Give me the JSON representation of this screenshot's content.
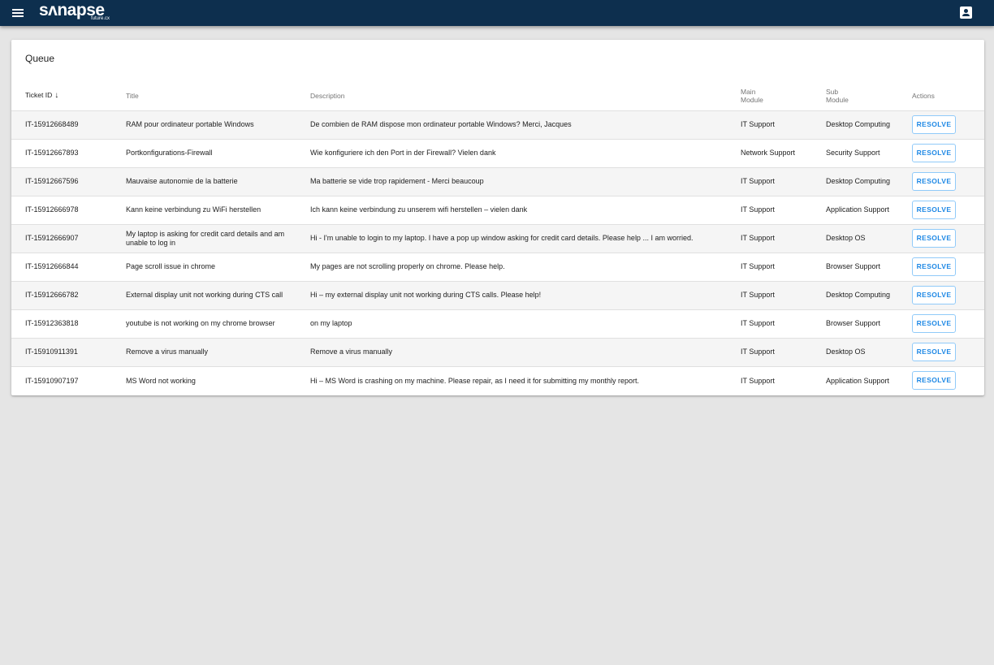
{
  "app": {
    "logo_text": "sʌnapse",
    "logo_subtext": "future.cx"
  },
  "queue": {
    "title": "Queue",
    "columns": [
      "Ticket ID",
      "Title",
      "Description",
      "Main Module",
      "Sub Module",
      "Actions"
    ],
    "sort_column": "Ticket ID",
    "sort_direction": "descending",
    "rows": [
      {
        "id": "IT-15912668489",
        "title": "RAM pour ordinateur portable Windows",
        "description": "De combien de RAM dispose mon ordinateur portable Windows? Merci, Jacques",
        "main": "IT Support",
        "sub": "Desktop Computing",
        "action": "RESOLVE"
      },
      {
        "id": "IT-15912667893",
        "title": "Portkonfigurations-Firewall",
        "description": "Wie konfiguriere ich den Port in der Firewall? Vielen dank",
        "main": "Network Support",
        "sub": "Security Support",
        "action": "RESOLVE"
      },
      {
        "id": "IT-15912667596",
        "title": "Mauvaise autonomie de la batterie",
        "description": "Ma batterie se vide trop rapidement - Merci beaucoup",
        "main": "IT Support",
        "sub": "Desktop Computing",
        "action": "RESOLVE"
      },
      {
        "id": "IT-15912666978",
        "title": "Kann keine verbindung zu WiFi herstellen",
        "description": "Ich kann keine verbindung zu unserem wifi herstellen – vielen dank",
        "main": "IT Support",
        "sub": "Application Support",
        "action": "RESOLVE"
      },
      {
        "id": "IT-15912666907",
        "title": "My laptop is asking for credit card details and am unable to log in",
        "description": "Hi - I'm unable to login to my laptop. I have a pop up window asking for credit card details. Please help ... I am worried.",
        "main": "IT Support",
        "sub": "Desktop OS",
        "action": "RESOLVE"
      },
      {
        "id": "IT-15912666844",
        "title": "Page scroll issue in chrome",
        "description": "My pages are not scrolling properly on chrome. Please help.",
        "main": "IT Support",
        "sub": "Browser Support",
        "action": "RESOLVE"
      },
      {
        "id": "IT-15912666782",
        "title": "External display unit not working during CTS call",
        "description": "Hi – my external display unit not working during CTS calls. Please help!",
        "main": "IT Support",
        "sub": "Desktop Computing",
        "action": "RESOLVE"
      },
      {
        "id": "IT-15912363818",
        "title": "youtube is not working on my chrome browser",
        "description": "on my laptop",
        "main": "IT Support",
        "sub": "Browser Support",
        "action": "RESOLVE"
      },
      {
        "id": "IT-15910911391",
        "title": "Remove a virus manually",
        "description": "Remove a virus manually",
        "main": "IT Support",
        "sub": "Desktop OS",
        "action": "RESOLVE"
      },
      {
        "id": "IT-15910907197",
        "title": "MS Word not working",
        "description": "Hi – MS Word is crashing on my machine. Please repair, as I need it for submitting my monthly report.",
        "main": "IT Support",
        "sub": "Application Support",
        "action": "RESOLVE"
      }
    ]
  },
  "icons": {
    "menu": "menu-icon",
    "account": "account-box-icon",
    "sort": "arrow-down-icon"
  },
  "colors": {
    "appbar": "#0d2f4e",
    "accent": "#1e88e5",
    "background": "#e5e5e5"
  }
}
